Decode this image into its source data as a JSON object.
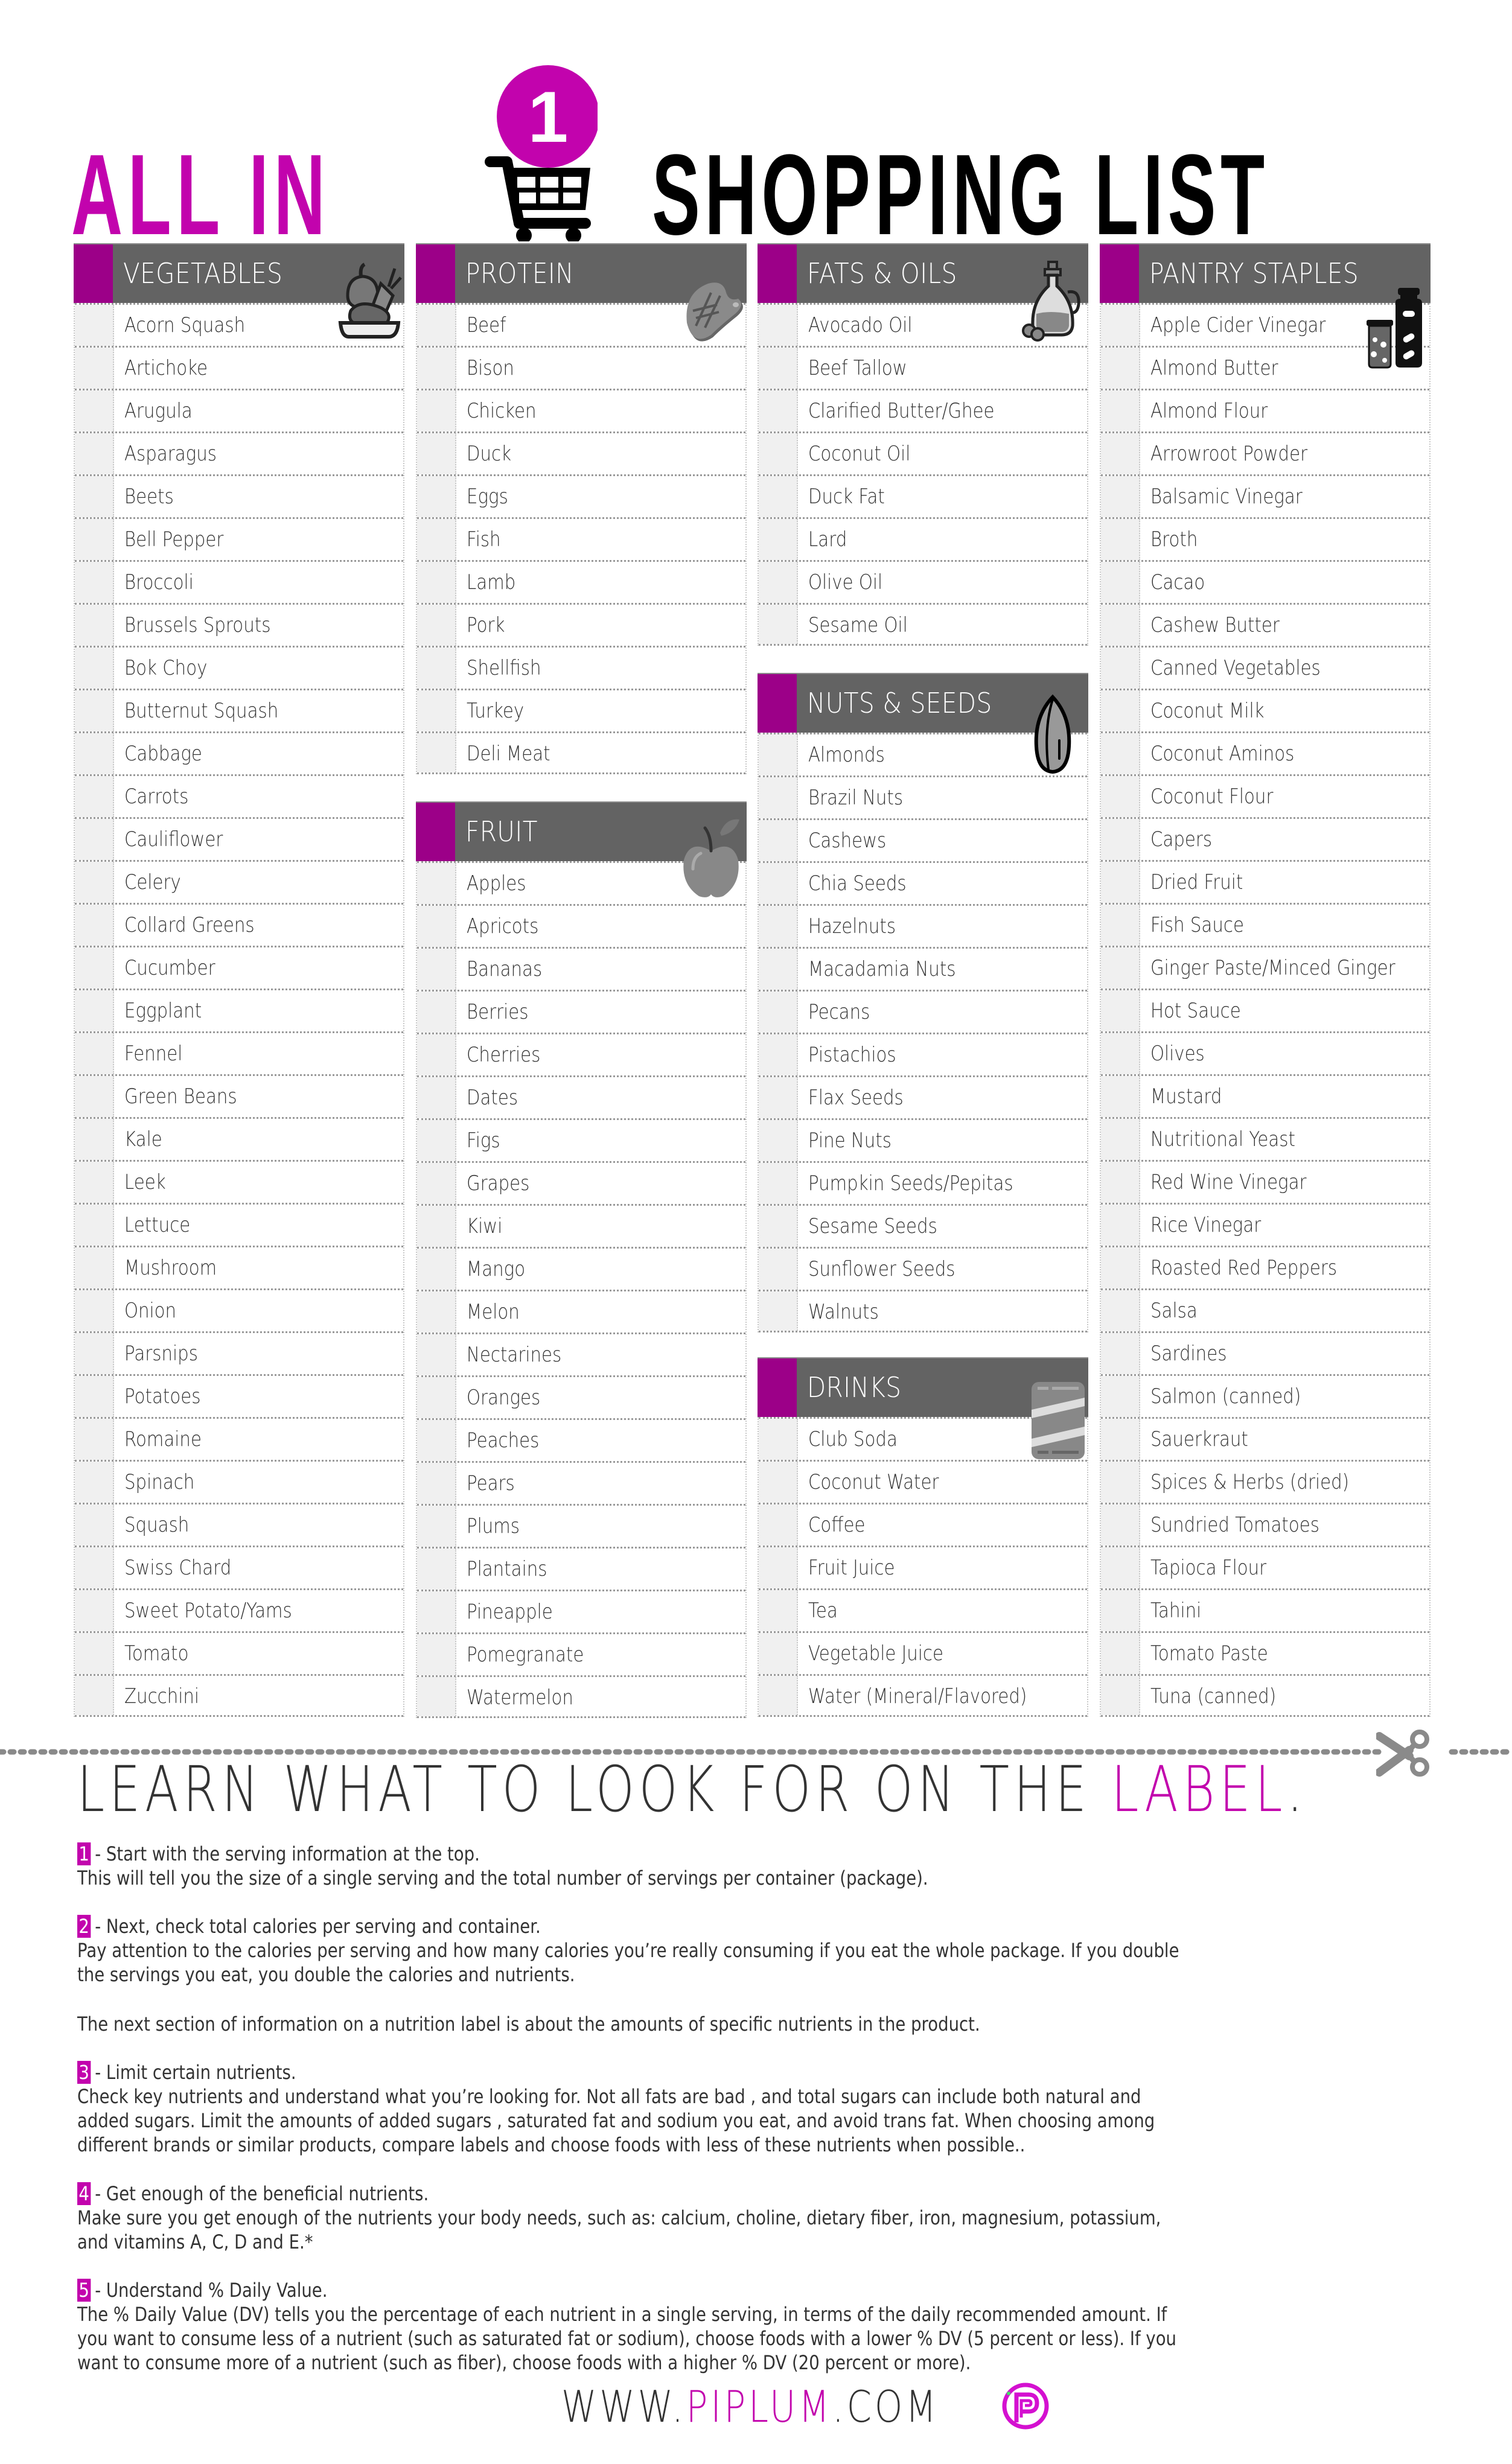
{
  "title": {
    "left": "ALL IN",
    "badge_number": "1",
    "right": "SHOPPING LIST"
  },
  "colors": {
    "accent": "#c203ad",
    "stripe": "#9c0088",
    "header_bg": "#636363",
    "row_box": "#f0f0f0"
  },
  "sections": {
    "vegetables": {
      "label": "VEGETABLES",
      "icon": "vegetable-basket-icon",
      "items": [
        "Acorn Squash",
        "Artichoke",
        "Arugula",
        "Asparagus",
        "Beets",
        "Bell Pepper",
        "Broccoli",
        "Brussels Sprouts",
        "Bok Choy",
        "Butternut Squash",
        "Cabbage",
        "Carrots",
        "Cauliflower",
        "Celery",
        "Collard Greens",
        "Cucumber",
        "Eggplant",
        "Fennel",
        "Green Beans",
        "Kale",
        "Leek",
        "Lettuce",
        "Mushroom",
        "Onion",
        "Parsnips",
        "Potatoes",
        "Romaine",
        "Spinach",
        "Squash",
        "Swiss Chard",
        "Sweet Potato/Yams",
        "Tomato",
        "Zucchini"
      ]
    },
    "protein": {
      "label": "PROTEIN",
      "icon": "steak-icon",
      "items": [
        "Beef",
        "Bison",
        "Chicken",
        "Duck",
        "Eggs",
        "Fish",
        "Lamb",
        "Pork",
        "Shellfish",
        "Turkey",
        "Deli Meat"
      ]
    },
    "fruit": {
      "label": "FRUIT",
      "icon": "apple-icon",
      "items": [
        "Apples",
        "Apricots",
        "Bananas",
        "Berries",
        "Cherries",
        "Dates",
        "Figs",
        "Grapes",
        "Kiwi",
        "Mango",
        "Melon",
        "Nectarines",
        "Oranges",
        "Peaches",
        "Pears",
        "Plums",
        "Plantains",
        "Pineapple",
        "Pomegranate",
        "Watermelon"
      ]
    },
    "fats_oils": {
      "label": "FATS & OILS",
      "icon": "oil-bottle-icon",
      "items": [
        "Avocado Oil",
        "Beef Tallow",
        "Clarified Butter/Ghee",
        "Coconut Oil",
        "Duck Fat",
        "Lard",
        "Olive Oil",
        "Sesame Oil"
      ]
    },
    "nuts_seeds": {
      "label": "NUTS & SEEDS",
      "icon": "seed-icon",
      "items": [
        "Almonds",
        "Brazil Nuts",
        "Cashews",
        "Chia Seeds",
        "Hazelnuts",
        "Macadamia Nuts",
        "Pecans",
        "Pistachios",
        "Flax Seeds",
        "Pine Nuts",
        "Pumpkin Seeds/Pepitas",
        "Sesame Seeds",
        "Sunflower Seeds",
        "Walnuts"
      ]
    },
    "drinks": {
      "label": "DRINKS",
      "icon": "can-icon",
      "items": [
        "Club Soda",
        "Coconut Water",
        "Coffee",
        "Fruit Juice",
        "Tea",
        "Vegetable Juice",
        "Water (Mineral/Flavored)"
      ]
    },
    "pantry": {
      "label": "PANTRY STAPLES",
      "icon": "jars-icon",
      "items": [
        "Apple Cider Vinegar",
        "Almond Butter",
        "Almond Flour",
        "Arrowroot Powder",
        "Balsamic Vinegar",
        "Broth",
        "Cacao",
        "Cashew Butter",
        "Canned Vegetables",
        "Coconut Milk",
        "Coconut Aminos",
        "Coconut Flour",
        "Capers",
        "Dried Fruit",
        "Fish Sauce",
        "Ginger Paste/Minced Ginger",
        "Hot Sauce",
        "Olives",
        "Mustard",
        "Nutritional Yeast",
        "Red Wine Vinegar",
        "Rice Vinegar",
        "Roasted Red Peppers",
        "Salsa",
        "Sardines",
        "Salmon (canned)",
        "Sauerkraut",
        "Spices & Herbs (dried)",
        "Sundried Tomatoes",
        "Tapioca Flour",
        "Tahini",
        "Tomato Paste",
        "Tuna (canned)"
      ]
    }
  },
  "label_section": {
    "headline_prefix": "LEARN WHAT TO LOOK FOR ON THE ",
    "headline_accent": "LABEL",
    "headline_suffix": ".",
    "tips": [
      {
        "number": "1",
        "heading": "- Start with the serving information at the top.",
        "lines": [
          "This will tell you the size of a single serving and the total number of servings per container (package)."
        ]
      },
      {
        "number": "2",
        "heading": "- Next, check total calories per serving and container.",
        "lines": [
          "Pay attention to the calories per serving and how many calories you’re really consuming if you eat the whole package. If you double",
          "the servings you eat, you double the calories and nutrients."
        ]
      },
      {
        "number": "",
        "heading": "",
        "lines": [
          "The next section of information on a nutrition label is about the amounts of specific nutrients in the product."
        ]
      },
      {
        "number": "3",
        "heading": "- Limit certain nutrients.",
        "lines": [
          "Check key nutrients and understand what you’re looking for. Not all fats are bad , and total sugars can include both natural and",
          "added sugars. Limit the amounts of added sugars , saturated fat  and sodium you eat, and avoid trans fat. When choosing among",
          "different brands or similar products, compare labels and choose foods with less of these nutrients when possible.."
        ]
      },
      {
        "number": "4",
        "heading": "- Get enough of the beneficial nutrients.",
        "lines": [
          "Make sure you get enough of the nutrients your body needs, such as: calcium, choline, dietary fiber, iron, magnesium, potassium,",
          "and vitamins A, C, D and E.*"
        ]
      },
      {
        "number": "5",
        "heading": "- Understand % Daily Value.",
        "lines": [
          "The % Daily Value (DV) tells you the percentage of each nutrient in a single serving, in terms of the daily recommended amount. If",
          "you want to consume less of a nutrient (such as saturated fat or sodium), choose foods with a lower % DV (5 percent or less). If you",
          "want to consume more of a nutrient (such as fiber), choose foods with a higher % DV (20 percent or more)."
        ]
      }
    ]
  },
  "footer": {
    "prefix": "WWW.",
    "brand": "PIPLUM",
    "suffix": ".COM",
    "logo_icon": "piplum-logo-icon"
  }
}
